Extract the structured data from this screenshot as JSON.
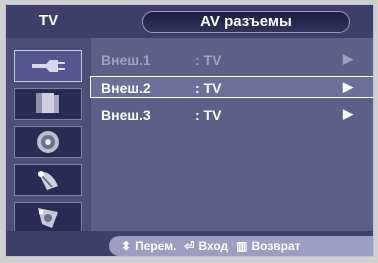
{
  "header": {
    "left_label": "TV",
    "title": "AV разъемы"
  },
  "sidebar": {
    "items": [
      {
        "icon": "antenna-plug-icon"
      },
      {
        "icon": "picture-icon"
      },
      {
        "icon": "sound-speaker-icon"
      },
      {
        "icon": "channel-satellite-icon"
      },
      {
        "icon": "setup-icon"
      }
    ]
  },
  "menu": {
    "rows": [
      {
        "label": "Внеш.1",
        "value": ": TV",
        "arrow": "▶",
        "state": "disabled"
      },
      {
        "label": "Внеш.2",
        "value": ": TV",
        "arrow": "▶",
        "state": "selected"
      },
      {
        "label": "Внеш.3",
        "value": ": TV",
        "arrow": "▶",
        "state": "normal"
      }
    ]
  },
  "footer": {
    "move_icon": "⬍",
    "move_label": "Перем.",
    "enter_icon": "⏎",
    "enter_label": "Вход",
    "return_icon": "▥",
    "return_label": "Возврат"
  },
  "colors": {
    "panel": "#5e5f87",
    "bar": "#3e3f68",
    "highlight_border": "#ffffff"
  }
}
